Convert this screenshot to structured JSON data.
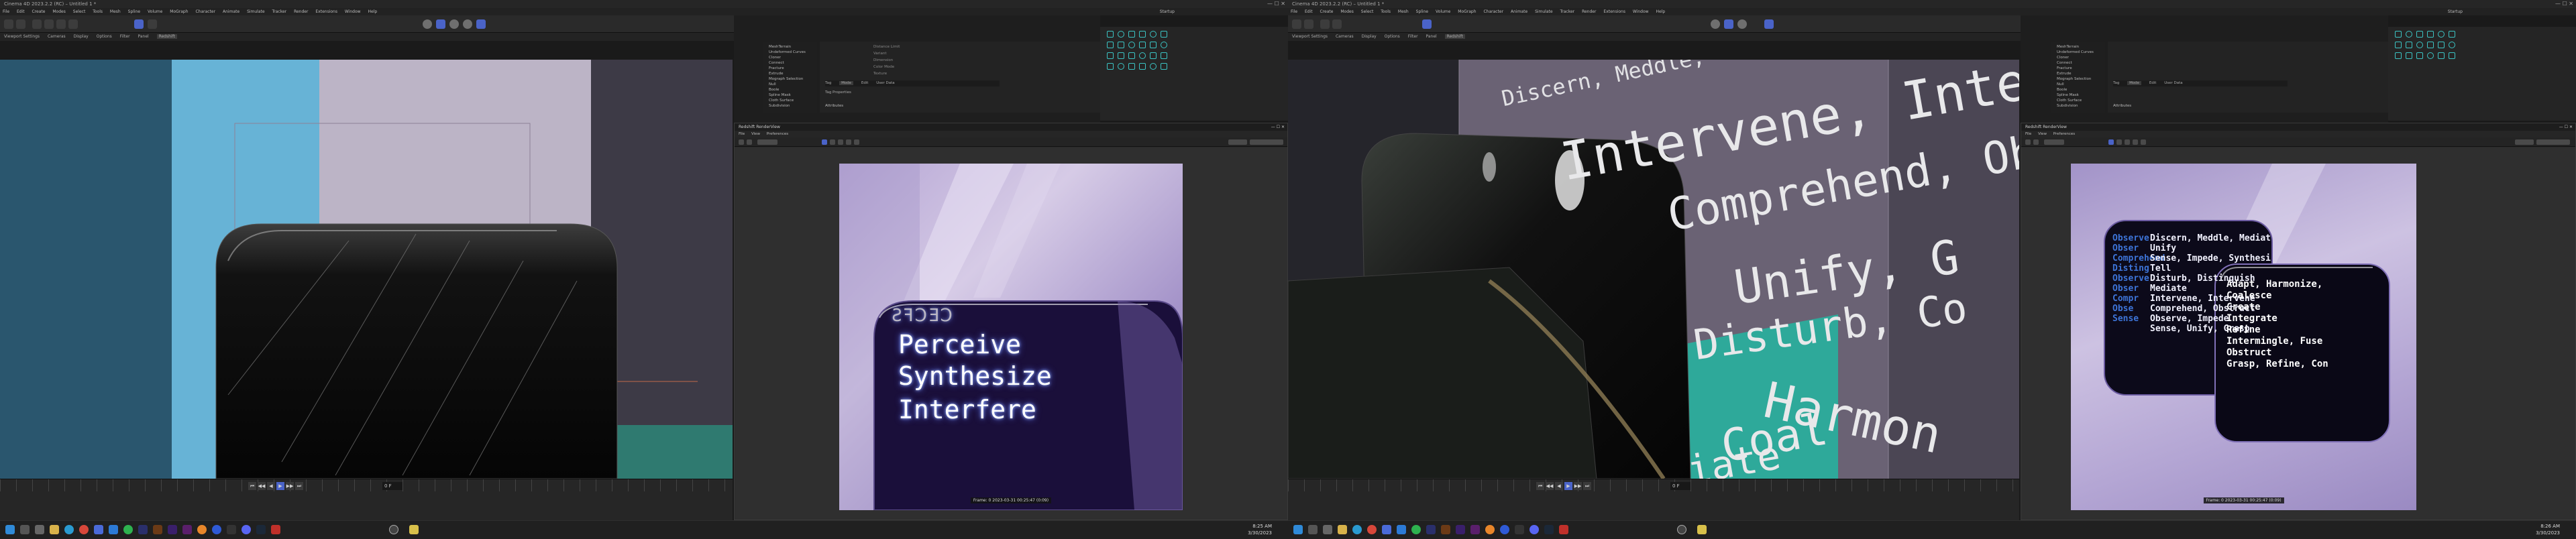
{
  "colors": {
    "accent": "#4a63c8",
    "icon_cyan": "#3bc4c4",
    "panel_bg": "#222222",
    "viewport_lavender": "#b3a8c4"
  },
  "monitor1": {
    "title": "Cinema 4D 2023.2.2 (RC) – Untitled 1 *",
    "menus": [
      "File",
      "Edit",
      "Create",
      "Modes",
      "Select",
      "Tools",
      "Mesh",
      "Spline",
      "Volume",
      "MoGraph",
      "Character",
      "Animate",
      "Simulate",
      "Tracker",
      "Render",
      "Extensions",
      "Window",
      "Help"
    ],
    "layout_label": "Startup",
    "subtabs": [
      "Viewport Settings",
      "Cameras",
      "Display",
      "Options",
      "Filter",
      "Panel",
      "Redshift"
    ],
    "objects_list": [
      "MeshTerrain",
      "Undeformed Curves",
      "Cloner",
      "Connect",
      "Fracture",
      "Extrude",
      "Mograph Selection",
      "Null",
      "Boole",
      "Spline Mask",
      "Cloth Surface",
      "Subdivision",
      "Pin"
    ],
    "attr_labels": [
      "Tag",
      "Mode",
      "Edit",
      "User Data"
    ],
    "attr_tag_props": "Tag Properties",
    "attr_fields": [
      "Distance Limit",
      "Variant",
      "Dimension",
      "Color Mode",
      "Texture"
    ],
    "attr_object_label": "Attributes",
    "timeline_frame": "0 F",
    "transport": [
      "⏮",
      "◀◀",
      "◀",
      "▶",
      "▶▶",
      "⏭"
    ],
    "renderview": {
      "title": "Redshift RenderView",
      "menus": [
        "File",
        "View",
        "Preferences"
      ],
      "text_lines": [
        "Perceive",
        "Synthesize",
        "Interfere"
      ],
      "text_top": "ƧꟻꓛƎꓛ",
      "stamp": "Frame: 0   2023-03-31 00:25:47   (0:09)"
    },
    "clock_time": "8:25 AM",
    "clock_date": "3/30/2023"
  },
  "monitor2": {
    "title": "Cinema 4D 2023.2.2 (RC) – Untitled 1 *",
    "layout_label": "Startup",
    "viewport_words": [
      "Discern, Meddle, Com",
      "Intervene, Integr",
      "Comprehend, Obstru",
      "Unify, G",
      "Disturb, Co",
      "Harmon",
      "Coal",
      "iate"
    ],
    "objects_list": [
      "MeshTerrain",
      "Undeformed Curves",
      "Cloner",
      "Connect",
      "Fracture",
      "Extrude",
      "Mograph Selection",
      "Null",
      "Boole",
      "Spline Mask",
      "Cloth Surface",
      "Subdivision",
      "Pin"
    ],
    "renderview": {
      "title": "Redshift RenderView",
      "menus": [
        "File",
        "View",
        "Preferences"
      ],
      "code_lines_blue": [
        "Observe",
        "Obser",
        "Comprehend",
        "Disting",
        "Observe",
        "Obser",
        "Compr",
        "Obse",
        "Sense"
      ],
      "code_lines_white": [
        "Discern, Meddle, Mediate",
        "Unify",
        "Sense, Impede, Synthesize",
        "Tell",
        "Disturb, Distinguish",
        "Mediate",
        "Intervene, Intervene",
        "Comprehend, Obstruct",
        "Observe, Impede",
        "Sense, Unify, Grasp"
      ],
      "code_lines_front": [
        "Adapt, Harmonize,",
        "Coalesce",
        "Create",
        "Integrate",
        "Refine",
        "Intermingle, Fuse",
        "Obstruct",
        "Grasp, Refine, Con"
      ],
      "stamp": "Frame: 0   2023-03-31 00:25:47   (0:09)"
    },
    "clock_time": "8:26 AM",
    "clock_date": "3/30/2023"
  },
  "taskbar": {
    "icons": [
      "windows-icon",
      "search-icon",
      "taskview-icon",
      "explorer-icon",
      "edge-icon",
      "chrome-icon",
      "store-icon",
      "mail-icon",
      "spotify-icon",
      "photoshop-icon",
      "illustrator-icon",
      "aftereffects-icon",
      "premiere-icon",
      "blender-icon",
      "c4d-icon",
      "terminal-icon",
      "discord-icon",
      "steam-icon",
      "redshift-icon",
      "obs-icon",
      "notes-icon"
    ]
  }
}
